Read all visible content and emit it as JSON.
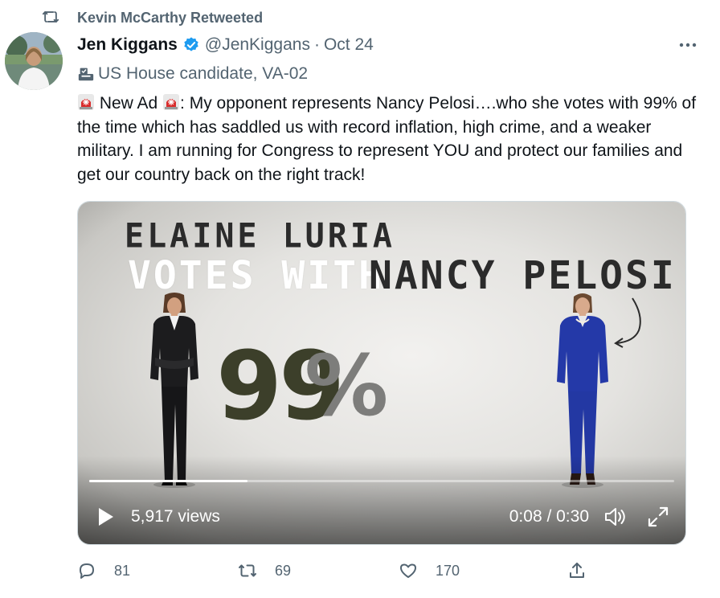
{
  "retweet": {
    "label": "Kevin McCarthy Retweeted",
    "icon": "retweet-icon"
  },
  "author": {
    "name": "Jen Kiggans",
    "handle": "@JenKiggans",
    "separator": "·",
    "date": "Oct 24",
    "verified_icon": "verified-badge-icon",
    "avatar": "avatar"
  },
  "label": {
    "icon": "ballot-box-icon",
    "text": "US House candidate, VA-02"
  },
  "tweet": {
    "segments": [
      " New Ad ",
      ": My opponent represents Nancy Pelosi….who she votes with 99% of the time which has  saddled us with record inflation, high crime, and a weaker military. I am running for Congress to represent YOU and protect our families and get our country back on the right track!"
    ],
    "emoji": "siren-icon"
  },
  "video": {
    "frame_text": {
      "line1": "ELAINE LURIA",
      "line2a": "VOTES WITH",
      "line2b": "NANCY PELOSI",
      "percent_number": "99",
      "percent_symbol": "%"
    },
    "views": "5,917 views",
    "time": "0:08 / 0:30",
    "progress": 0.27
  },
  "actions": {
    "replies": "81",
    "retweets": "69",
    "likes": "170"
  },
  "colors": {
    "text": "#0f1419",
    "secondary": "#536471",
    "verified": "#1d9bf0"
  }
}
